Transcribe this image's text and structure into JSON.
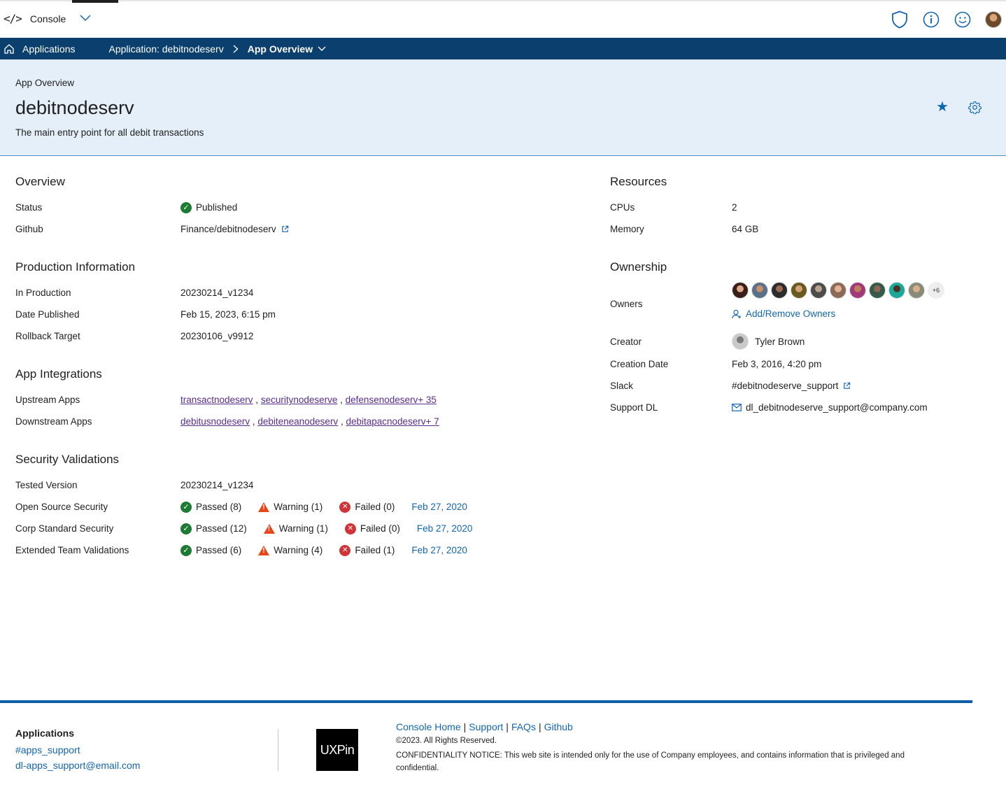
{
  "topbar": {
    "brand": "Console",
    "icons": [
      "code-icon",
      "chevron-down-icon",
      "shield-icon",
      "info-icon",
      "smiley-icon",
      "user-avatar"
    ]
  },
  "breadcrumb": {
    "home": "Applications",
    "app": "Application: debitnodeserv",
    "current": "App Overview"
  },
  "header": {
    "eyebrow": "App Overview",
    "title": "debitnodeserv",
    "description": "The main entry point for all debit transactions"
  },
  "overview": {
    "heading": "Overview",
    "status_label": "Status",
    "status_value": "Published",
    "github_label": "Github",
    "github_value": "Finance/debitnodeserv"
  },
  "production": {
    "heading": "Production Information",
    "in_production_label": "In Production",
    "in_production_value": "20230214_v1234",
    "date_published_label": "Date Published",
    "date_published_value": "Feb 15, 2023, 6:15 pm",
    "rollback_label": "Rollback Target",
    "rollback_value": "20230106_v9912"
  },
  "integrations": {
    "heading": "App Integrations",
    "upstream_label": "Upstream Apps",
    "upstream": [
      "transactnodeserv",
      "securitynodeserve",
      "defensenodeserv+ 35"
    ],
    "downstream_label": "Downstream Apps",
    "downstream": [
      "debitusnodeserv",
      "debiteneanodeserv",
      "debitapacnodeserv+ 7"
    ]
  },
  "security": {
    "heading": "Security Validations",
    "tested_label": "Tested Version",
    "tested_value": "20230214_v1234",
    "rows": [
      {
        "label": "Open Source Security",
        "passed": "Passed (8)",
        "warning": "Warning (1)",
        "failed": "Failed (0)",
        "date": "Feb 27, 2020"
      },
      {
        "label": "Corp Standard Security",
        "passed": "Passed (12)",
        "warning": "Warning (1)",
        "failed": "Failed (0)",
        "date": "Feb 27, 2020"
      },
      {
        "label": "Extended Team Validations",
        "passed": "Passed (6)",
        "warning": "Warning (4)",
        "failed": "Failed (1)",
        "date": "Feb 27, 2020"
      }
    ]
  },
  "resources": {
    "heading": "Resources",
    "cpus_label": "CPUs",
    "cpus_value": "2",
    "memory_label": "Memory",
    "memory_value": "64 GB"
  },
  "ownership": {
    "heading": "Ownership",
    "owners_label": "Owners",
    "owners_more": "+6",
    "add_remove": "Add/Remove Owners",
    "creator_label": "Creator",
    "creator_value": "Tyler Brown",
    "creation_date_label": "Creation Date",
    "creation_date_value": "Feb 3, 2016, 4:20 pm",
    "slack_label": "Slack",
    "slack_value": "#debitnodeserve_support",
    "support_label": "Support DL",
    "support_value": "dl_debitnodeserve_support@company.com"
  },
  "footer": {
    "title": "Applications",
    "slack": "#apps_support",
    "email": "dl-apps_support@email.com",
    "logo": "UXPin",
    "links": [
      "Console Home",
      "Support",
      "FAQs",
      "Github"
    ],
    "copyright": "©2023. All Rights Reserved.",
    "notice": "CONFIDENTIALITY NOTICE: This web site is intended only for the use of Company employees, and contains information that is privileged and confidential."
  },
  "colors": {
    "nav_bar": "#0a3f6e",
    "hero_bg": "#e4eff9",
    "link": "#1366b3",
    "success": "#1e7b34",
    "warning": "#e6471a",
    "error": "#d13438"
  }
}
